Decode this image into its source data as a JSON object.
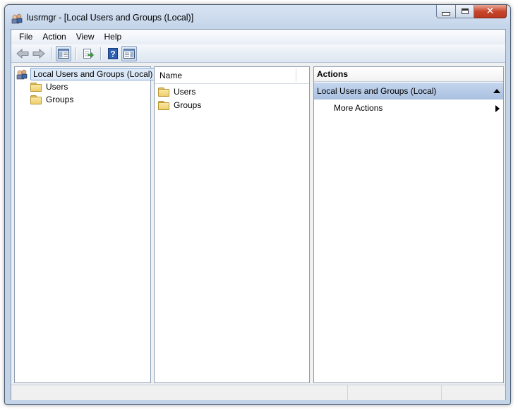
{
  "window": {
    "title": "lusrmgr - [Local Users and Groups (Local)]",
    "app_icon": "users-groups-icon"
  },
  "caption_buttons": [
    "minimize-icon",
    "maximize-icon",
    "close-icon"
  ],
  "menu": {
    "items": [
      "File",
      "Action",
      "View",
      "Help"
    ]
  },
  "toolbar": {
    "buttons": [
      "back-arrow-icon",
      "forward-arrow-icon",
      "show-hide-console-tree-icon",
      "export-list-icon",
      "help-icon",
      "show-hide-action-pane-icon"
    ]
  },
  "tree": {
    "root_label": "Local Users and Groups (Local)",
    "children": [
      "Users",
      "Groups"
    ]
  },
  "list": {
    "column_name": "Name",
    "items": [
      "Users",
      "Groups"
    ]
  },
  "actions": {
    "header": "Actions",
    "group_title": "Local Users and Groups (Local)",
    "more_actions": "More Actions"
  },
  "colors": {
    "selection_bg": "#dce9f9",
    "actions_group_bg": "#b7cbe7",
    "folder_yellow": "#efcf6c"
  }
}
